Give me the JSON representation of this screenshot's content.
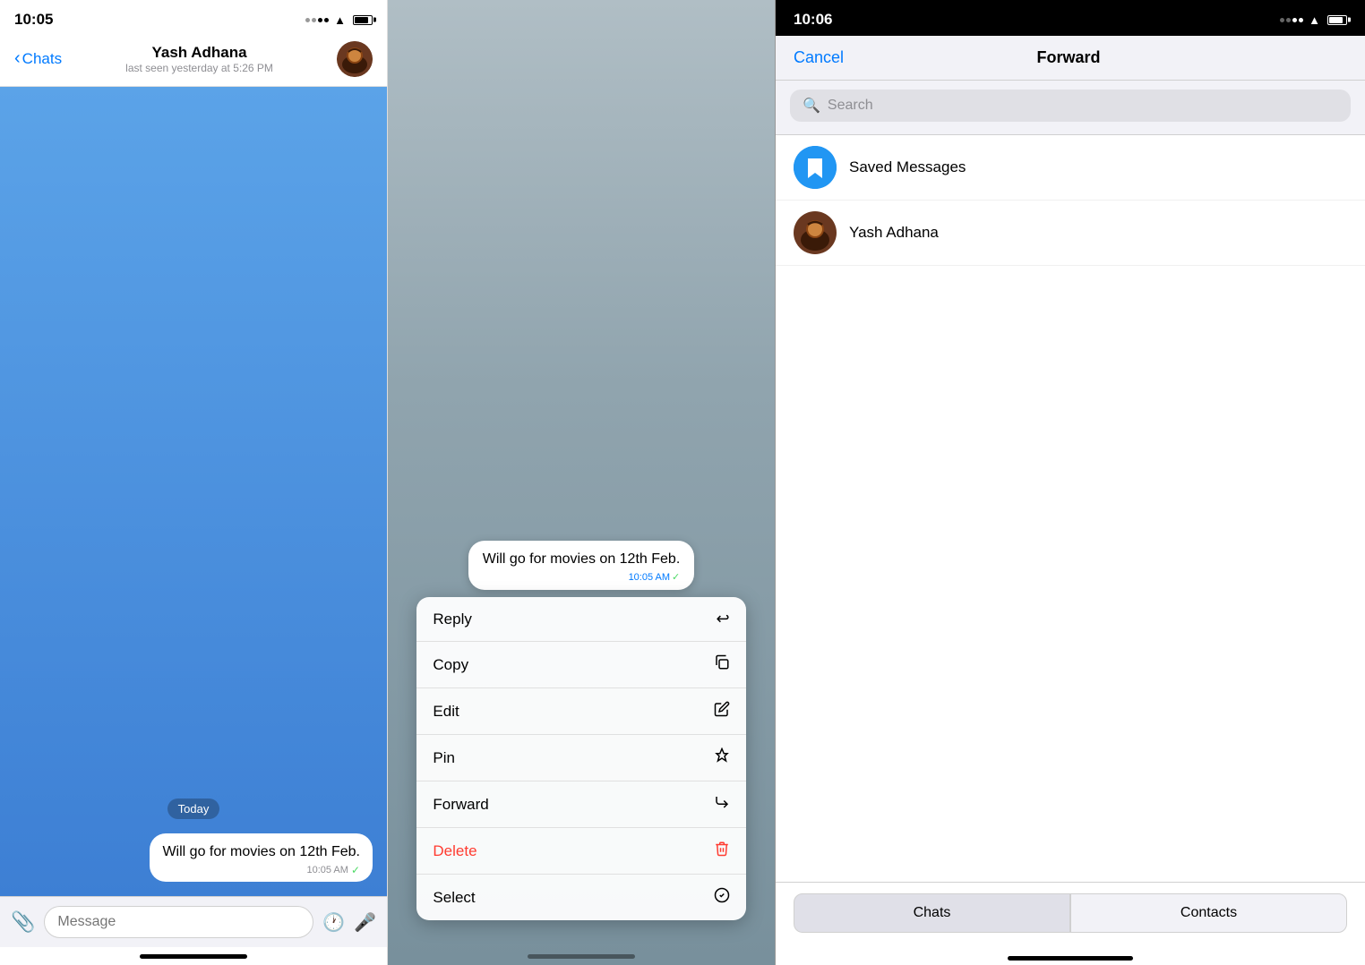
{
  "panel1": {
    "status_time": "10:05",
    "back_label": "Chats",
    "contact_name": "Yash Adhana",
    "contact_status": "last seen yesterday at 5:26 PM",
    "date_badge": "Today",
    "message_text": "Will go for movies on 12th Feb.",
    "message_time": "10:05 AM",
    "input_placeholder": "Message",
    "home_bar": true
  },
  "panel2": {
    "preview_text": "Will go for movies on 12th Feb.",
    "preview_time": "10:05 AM",
    "menu_items": [
      {
        "label": "Reply",
        "icon": "↩",
        "type": "normal"
      },
      {
        "label": "Copy",
        "icon": "⧉",
        "type": "normal"
      },
      {
        "label": "Edit",
        "icon": "✎",
        "type": "normal"
      },
      {
        "label": "Pin",
        "icon": "📌",
        "type": "normal"
      },
      {
        "label": "Forward",
        "icon": "↪",
        "type": "normal"
      },
      {
        "label": "Delete",
        "icon": "🗑",
        "type": "delete"
      },
      {
        "label": "Select",
        "icon": "✓",
        "type": "normal"
      }
    ]
  },
  "panel3": {
    "status_time": "10:06",
    "cancel_label": "Cancel",
    "title": "Forward",
    "search_placeholder": "Search",
    "contacts": [
      {
        "name": "Saved Messages",
        "type": "saved"
      },
      {
        "name": "Yash Adhana",
        "type": "user"
      }
    ],
    "tabs": [
      {
        "label": "Chats",
        "active": true
      },
      {
        "label": "Contacts",
        "active": false
      }
    ]
  }
}
